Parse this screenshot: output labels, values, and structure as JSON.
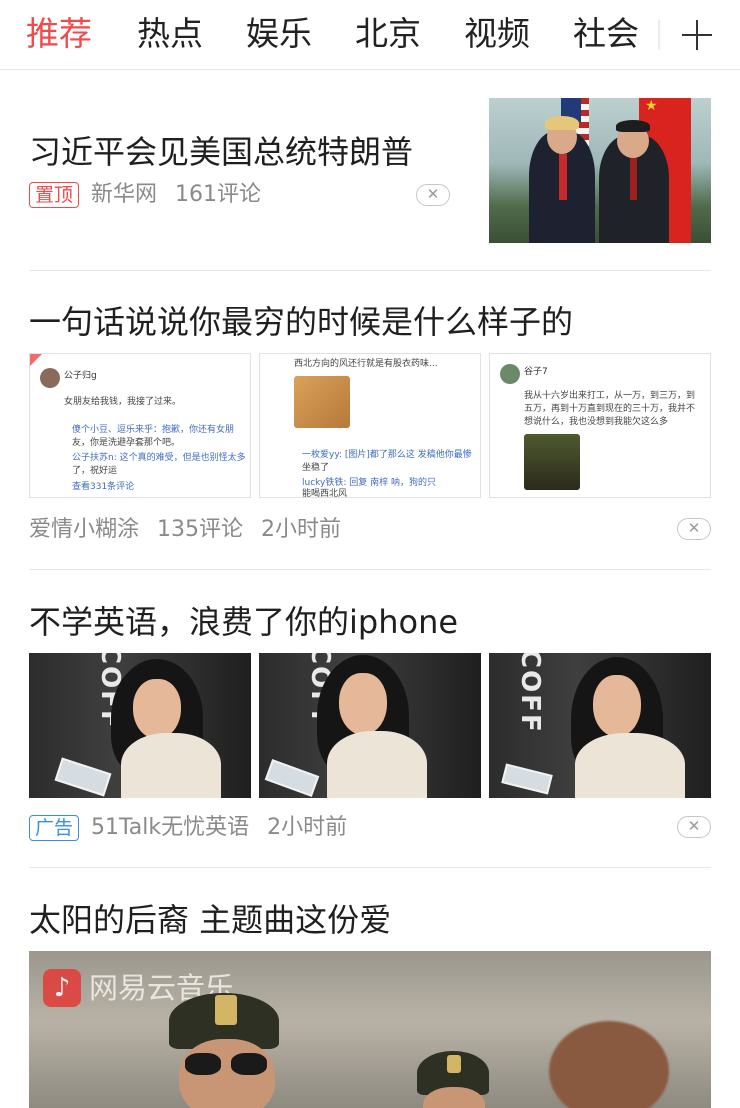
{
  "tabs": [
    "推荐",
    "热点",
    "娱乐",
    "北京",
    "视频",
    "社会"
  ],
  "add_channel": "+",
  "articles": [
    {
      "title": "习近平会见美国总统特朗普",
      "tag": "置顶",
      "source": "新华网",
      "comments": "161评论",
      "close": "✕"
    },
    {
      "title": "一句话说说你最穷的时候是什么样子的",
      "source": "爱情小糊涂",
      "comments": "135评论",
      "time": "2小时前",
      "close": "✕",
      "cards": [
        {
          "user": "公子归g",
          "lines": [
            "女朋友给我钱，我接了过来。",
            "傻个小豆、逗乐来乎：抱歉，你还有女朋",
            "友，你是洗避孕套那个吧。",
            "公子扶苏n: 这个真的难受，但是也别怪太多",
            "了，祝好运",
            "查看331条评论"
          ]
        },
        {
          "lines": [
            "西北方向的风还行就是有股衣药味...",
            "一枚爱yy: [图片]都了那么这 发稿他你最惨",
            "坐稳了",
            "lucky铁铁: 回复 南梓    呐，狗的只",
            "能喝西北风"
          ]
        },
        {
          "user": "谷子7",
          "lines": [
            "我从十六岁出来打工，从一万，到三万，到",
            "五万，再到十万直到现在的三十万，我并不",
            "想说什么，我也没想到我能欠这么多"
          ]
        }
      ]
    },
    {
      "title": "不学英语，浪费了你的iphone",
      "tag": "广告",
      "source": "51Talk无忧英语",
      "time": "2小时前",
      "close": "✕",
      "image_word": "COFF"
    },
    {
      "title": "太阳的后裔 主题曲这份爱",
      "video_brand": "网易云音乐"
    }
  ]
}
